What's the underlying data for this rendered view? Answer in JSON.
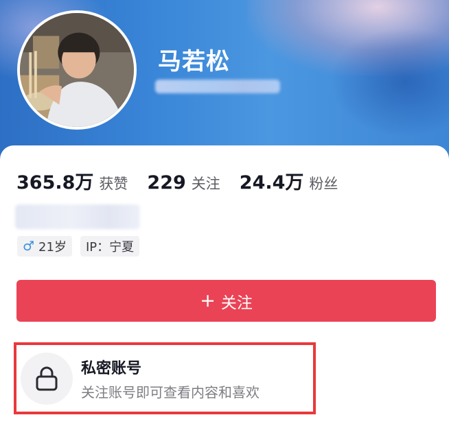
{
  "profile": {
    "nickname": "马若松",
    "account_id": "",
    "signature": ""
  },
  "stats": [
    {
      "value": "365.8万",
      "label": "获赞"
    },
    {
      "value": "229",
      "label": "关注"
    },
    {
      "value": "24.4万",
      "label": "粉丝"
    }
  ],
  "tags": {
    "gender_icon": "♂",
    "age": "21岁",
    "ip": "IP：宁夏"
  },
  "actions": {
    "follow_icon": "+",
    "follow_label": "关注"
  },
  "private_notice": {
    "title": "私密账号",
    "subtitle": "关注账号即可查看内容和喜欢"
  },
  "colors": {
    "banner_blue": "#3a86d8",
    "follow_red": "#ea4356",
    "highlight_border": "#e8393b",
    "male_blue": "#3a8ee0"
  },
  "icons": {
    "lock": "lock-icon",
    "male": "male-icon",
    "plus": "plus-icon"
  }
}
